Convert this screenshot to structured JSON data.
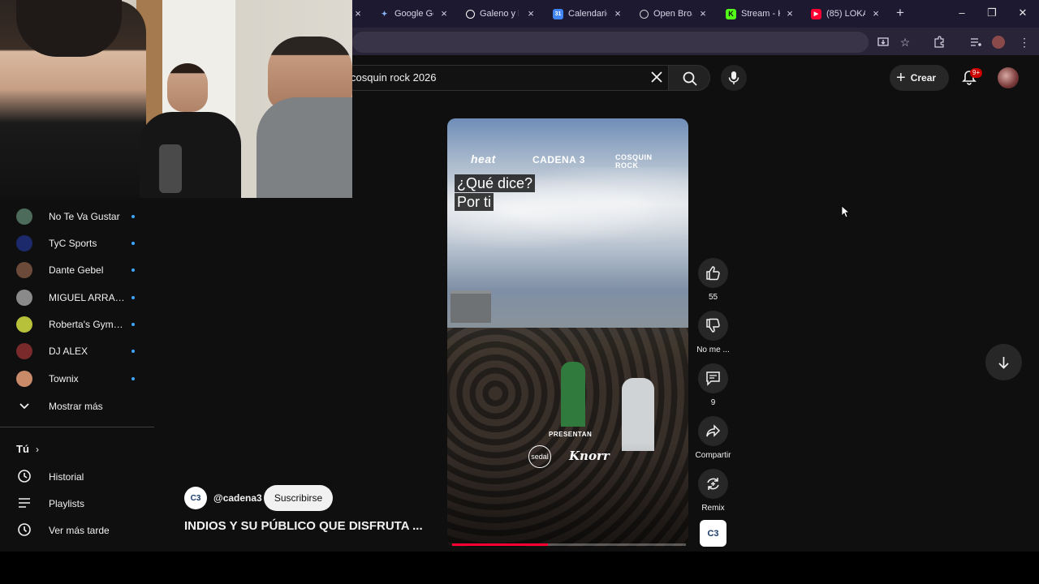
{
  "browser": {
    "tabs": [
      {
        "label": "",
        "favicon": "generic-icon",
        "color": "#1d1930"
      },
      {
        "label": "Google Ge",
        "favicon": "gemini-icon",
        "color": "#8ab4f8"
      },
      {
        "label": "Galeno y l",
        "favicon": "openai-icon",
        "color": "#ffffff"
      },
      {
        "label": "Calendario",
        "favicon": "calendar-icon",
        "color": "#4285f4"
      },
      {
        "label": "Open Broa",
        "favicon": "obs-icon",
        "color": "#cccccc"
      },
      {
        "label": "Stream - K",
        "favicon": "kick-icon",
        "color": "#53fc18"
      },
      {
        "label": "(85) LOKA",
        "favicon": "youtube-icon",
        "color": "#ff0033"
      }
    ]
  },
  "search": {
    "query": "cosquin rock 2026"
  },
  "header": {
    "create_label": "Crear",
    "notifications_badge": "9+"
  },
  "sidebar": {
    "subscriptions": [
      {
        "label": "No Te Va Gustar",
        "color": "#4c6b5a"
      },
      {
        "label": "TyC Sports",
        "color": "#1c2a6b"
      },
      {
        "label": "Dante Gebel",
        "color": "#6b4a3a"
      },
      {
        "label": "MIGUEL ARRAZ...",
        "color": "#8a8a8a"
      },
      {
        "label": "Roberta's Gym E...",
        "color": "#b7c23a"
      },
      {
        "label": "DJ ALEX",
        "color": "#7a2a2a"
      },
      {
        "label": "Townix",
        "color": "#c98a6a"
      }
    ],
    "show_more_label": "Mostrar más",
    "you_label": "Tú",
    "you_links": [
      {
        "label": "Historial",
        "icon": "history-icon"
      },
      {
        "label": "Playlists",
        "icon": "playlists-icon"
      },
      {
        "label": "Ver más tarde",
        "icon": "watch-later-icon"
      }
    ]
  },
  "video": {
    "brands": [
      "heat",
      "CADENA 3",
      "COSQUIN ROCK"
    ],
    "caption_lines": [
      "¿Qué dice?",
      "Por ti"
    ],
    "sponsor_label": "PRESENTAN",
    "sponsor_1": "sedal",
    "sponsor_2": "Knorr",
    "progress": 0.41
  },
  "actions": {
    "like_count": "55",
    "dislike_label": "No me ...",
    "comments_count": "9",
    "share_label": "Compartir",
    "remix_label": "Remix"
  },
  "channel": {
    "avatar_text": "C3",
    "handle": "@cadena3",
    "subscribe_label": "Suscribirse",
    "title": "INDIOS Y SU PÚBLICO QUE DISFRUTA ..."
  }
}
